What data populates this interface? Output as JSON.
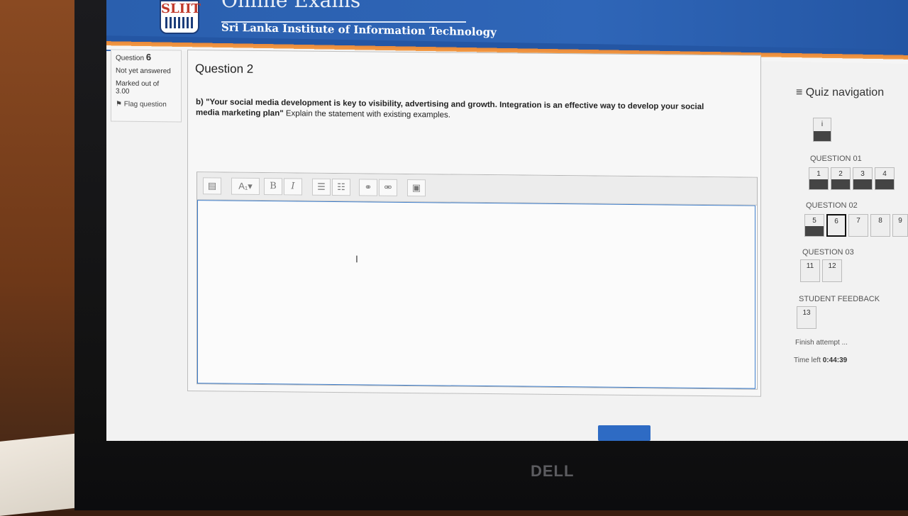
{
  "header": {
    "title": "Online Exams",
    "institution": "Sri Lanka Institute of Information Technology",
    "logo_text": "SLIIT"
  },
  "question_info": {
    "label": "Question",
    "number": "6",
    "status": "Not yet answered",
    "marks_label": "Marked out of",
    "marks": "3.00",
    "flag": "Flag question"
  },
  "question": {
    "title": "Question 2",
    "prefix": "b)",
    "quote": "\"Your social media development is key to visibility, advertising and growth. Integration is an effective way to develop your social media marketing plan\"",
    "instruction": "Explain the statement with existing examples."
  },
  "editor": {
    "toolbar": [
      "toggle-toolbar",
      "paragraph-styles",
      "bold",
      "italic",
      "unordered-list",
      "ordered-list",
      "link",
      "unlink",
      "image"
    ],
    "labels": {
      "bold": "B",
      "italic": "I",
      "styles": "A₁▾"
    }
  },
  "quiz_nav": {
    "title": "Quiz navigation",
    "top_button": "i",
    "sections": [
      {
        "label": "QUESTION 01",
        "buttons": [
          "1",
          "2",
          "3",
          "4"
        ]
      },
      {
        "label": "QUESTION 02",
        "buttons": [
          "5",
          "6",
          "7",
          "8",
          "9"
        ]
      },
      {
        "label": "QUESTION 03",
        "buttons": [
          "11",
          "12"
        ]
      },
      {
        "label": "STUDENT FEEDBACK",
        "buttons": [
          "13"
        ]
      }
    ],
    "finish": "Finish attempt ...",
    "time_label": "Time left",
    "time_value": "0:44:39"
  },
  "colors": {
    "banner": "#2a5fae",
    "accent_orange": "#f39a44",
    "editor_focus": "#3d7cc9"
  },
  "footer": {
    "brand": "DELL"
  }
}
